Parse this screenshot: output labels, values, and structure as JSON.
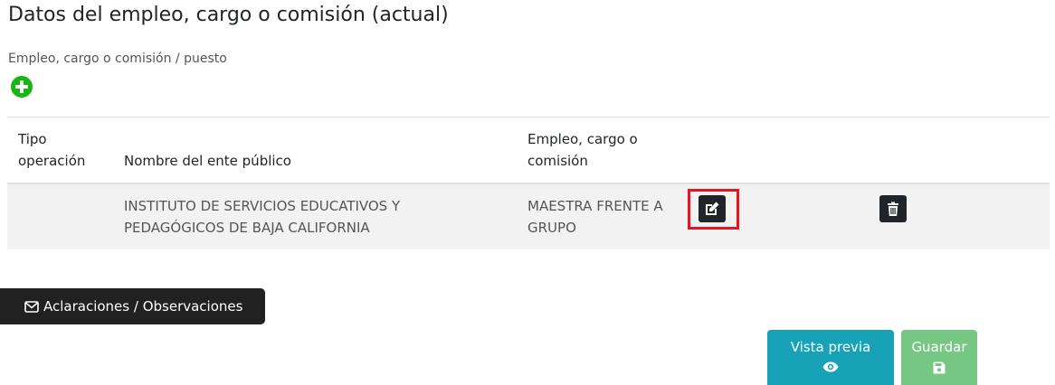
{
  "section": {
    "title": "Datos del empleo, cargo o comisión (actual)",
    "field_label": "Empleo, cargo o comisión / puesto"
  },
  "icons": {
    "add": "plus-circle-icon",
    "edit": "edit-icon",
    "delete": "trash-icon",
    "notes": "envelope-icon",
    "preview": "eye-icon",
    "save": "floppy-disk-icon"
  },
  "table": {
    "headers": {
      "tipo_operacion": "Tipo operación",
      "nombre_ente": "Nombre del ente público",
      "empleo": "Empleo, cargo o comisión"
    },
    "rows": [
      {
        "tipo_operacion": "",
        "nombre_ente": "INSTITUTO DE SERVICIOS EDUCATIVOS Y PEDAGÓGICOS DE BAJA CALIFORNIA",
        "empleo": "MAESTRA FRENTE A GRUPO"
      }
    ]
  },
  "buttons": {
    "notes_label": "Aclaraciones / Observaciones",
    "preview_label": "Vista previa",
    "save_label": "Guardar"
  },
  "colors": {
    "add_green": "#19b515",
    "dark": "#212529",
    "highlight_red": "#e8141e",
    "preview_teal": "#17a2b8",
    "save_green": "#77c784",
    "row_bg": "#f2f2f2"
  }
}
